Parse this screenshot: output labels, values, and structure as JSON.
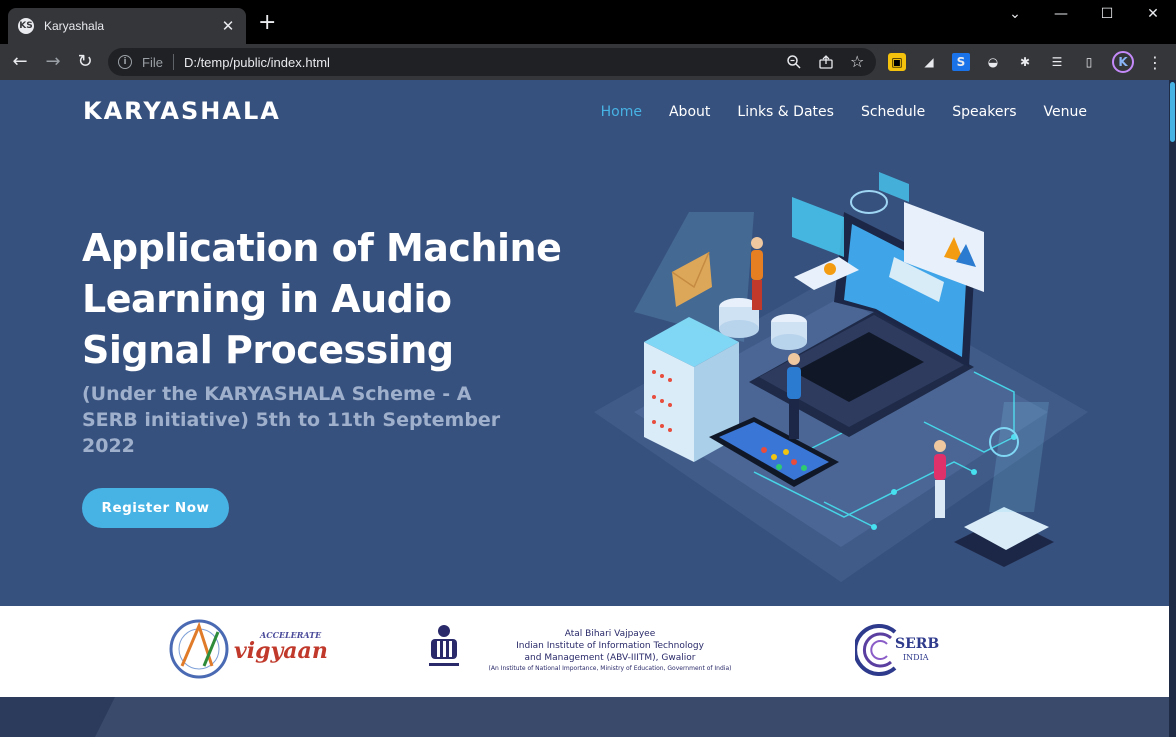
{
  "browser": {
    "tab_title": "Karyashala",
    "favicon_text": "KS",
    "new_tab": "+",
    "url_scheme": "File",
    "url": "D:/temp/public/index.html",
    "profile_initial": "K"
  },
  "site": {
    "logo": "KARYASHALA",
    "nav": [
      {
        "label": "Home",
        "active": true
      },
      {
        "label": "About"
      },
      {
        "label": "Links & Dates"
      },
      {
        "label": "Schedule"
      },
      {
        "label": "Speakers"
      },
      {
        "label": "Venue"
      }
    ],
    "hero": {
      "title": "Application of Machine Learning in Audio Signal Processing",
      "subtitle": "(Under the KARYASHALA Scheme - A SERB initiative) 5th to 11th September 2022",
      "cta": "Register Now"
    },
    "sponsors": {
      "vigyaan_top": "ACCELERATE",
      "vigyaan_name": "vigyaan",
      "abv_line1": "Atal Bihari Vajpayee",
      "abv_line2": "Indian Institute of Information Technology",
      "abv_line3": "and Management (ABV-IIITM), Gwalior",
      "abv_line4": "(An Institute of National Importance, Ministry of Education, Government of India)",
      "serb_name": "SERB",
      "serb_sub": "INDIA"
    }
  },
  "colors": {
    "hero_bg": "#37517e",
    "accent": "#47b2e4"
  }
}
